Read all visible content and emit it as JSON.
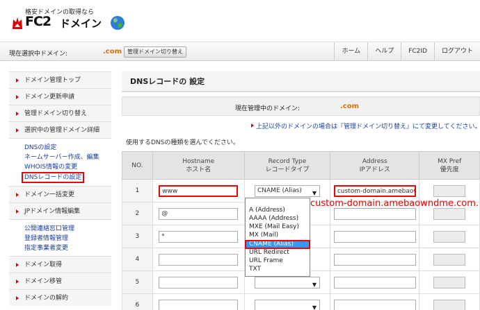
{
  "header": {
    "tagline": "格安ドメインの取得なら",
    "logo_fc2": "FC2",
    "logo_domain": "ドメイン",
    "logo_icon": "globe-icon"
  },
  "topbar": {
    "current_label": "現在選択中ドメイン:",
    "current_domain": ".com",
    "switch_button": "管理ドメイン切り替え",
    "nav": [
      "ホーム",
      "ヘルプ",
      "FC2ID",
      "ログアウト"
    ]
  },
  "sidebar": {
    "items": [
      "ドメイン管理トップ",
      "ドメイン更新申請",
      "管理ドメイン切り替え",
      "選択中の管理ドメイン詳細"
    ],
    "sub1": [
      "DNSの設定",
      "ネームサーバー作成、編集",
      "WHOIS情報の変更",
      "DNSレコードの設定"
    ],
    "items2": [
      "ドメイン一括変更",
      "JPドメイン情報編集"
    ],
    "sub2": [
      "公開連絡窓口管理",
      "登録者情報管理",
      "指定事業者変更"
    ],
    "items3": [
      "ドメイン取得",
      "ドメイン移管",
      "ドメインの解約"
    ]
  },
  "main": {
    "title": "DNSレコードの 設定",
    "manager_label": "現在管理中のドメイン:",
    "manager_domain": ".com",
    "notice": "上記以外のドメインの場合は『管理ドメイン切り替え』にて変更してください。",
    "instruction": "使用するDNSの種類を選んでください。",
    "table": {
      "headers": {
        "no": "NO.",
        "host_en": "Hostname",
        "host_ja": "ホスト名",
        "type_en": "Record Type",
        "type_ja": "レコードタイプ",
        "addr_en": "Address",
        "addr_ja": "IPアドレス",
        "mx_en": "MX Pref",
        "mx_ja": "優先度"
      },
      "rows": [
        {
          "no": "1",
          "host": "www",
          "type": "CNAME (Alias)",
          "addr": "custom-domain.amebaowndme.com."
        },
        {
          "no": "2",
          "host": "@",
          "type": "",
          "addr": ""
        },
        {
          "no": "3",
          "host": "*",
          "type": "",
          "addr": ""
        },
        {
          "no": "4",
          "host": "",
          "type": "",
          "addr": ""
        },
        {
          "no": "5",
          "host": "",
          "type": "",
          "addr": ""
        },
        {
          "no": "6",
          "host": "",
          "type": "",
          "addr": ""
        }
      ]
    },
    "dropdown_options": [
      "A (Address)",
      "AAAA (Address)",
      "MXE (Mail Easy)",
      "MX (Mail)",
      "CNAME (Alias)",
      "URL Redirect",
      "URL Frame",
      "TXT"
    ],
    "selected_option": "CNAME (Alias)",
    "callout": "custom-domain.amebaowndme.com."
  },
  "colors": {
    "accent_red": "#e00000",
    "link_blue": "#1a3e9c",
    "domain_orange": "#e07000",
    "select_blue": "#3399ff"
  }
}
